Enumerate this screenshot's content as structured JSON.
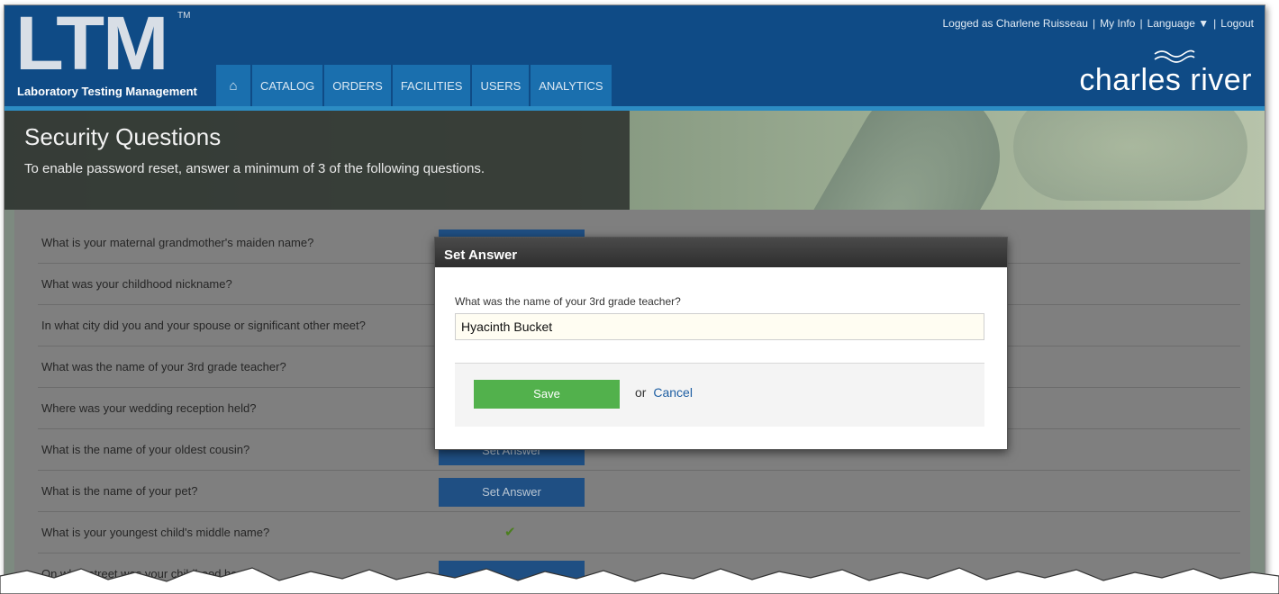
{
  "header": {
    "logo_text": "LTM",
    "logo_tm": "TM",
    "logo_subtitle": "Laboratory Testing Management",
    "nav": [
      "CATALOG",
      "ORDERS",
      "FACILITIES",
      "USERS",
      "ANALYTICS"
    ],
    "home_icon": "home-icon",
    "account": {
      "logged_as": "Logged as Charlene Ruisseau",
      "my_info": "My Info",
      "language": "Language ▼",
      "logout": "Logout"
    },
    "brand": "charles river"
  },
  "banner": {
    "title": "Security Questions",
    "subtitle": "To enable password reset, answer a minimum of 3 of the following questions."
  },
  "questions": [
    {
      "text": "What is your maternal grandmother's maiden name?",
      "action": "Set Answer"
    },
    {
      "text": "What was your childhood nickname?",
      "action": ""
    },
    {
      "text": "In what city did you and your spouse or significant other meet?",
      "action": ""
    },
    {
      "text": "What was the name of your 3rd grade teacher?",
      "action": ""
    },
    {
      "text": "Where was your wedding reception held?",
      "action": ""
    },
    {
      "text": "What is the name of your oldest cousin?",
      "action": "Set Answer"
    },
    {
      "text": "What is the name of your pet?",
      "action": "Set Answer"
    },
    {
      "text": "What is your youngest child's middle name?",
      "action": "✔"
    },
    {
      "text": "On what street was your childhood home?",
      "action": ""
    }
  ],
  "modal": {
    "title": "Set Answer",
    "question": "What was the name of your 3rd grade teacher?",
    "answer_value": "Hyacinth Bucket",
    "save_label": "Save",
    "or_text": "or",
    "cancel_label": "Cancel"
  },
  "colors": {
    "header_bg": "#0f4b86",
    "nav_bg": "#1a6fae",
    "button_blue": "#1f4f83",
    "save_green": "#52b14c",
    "link_blue": "#1f5fa3"
  }
}
